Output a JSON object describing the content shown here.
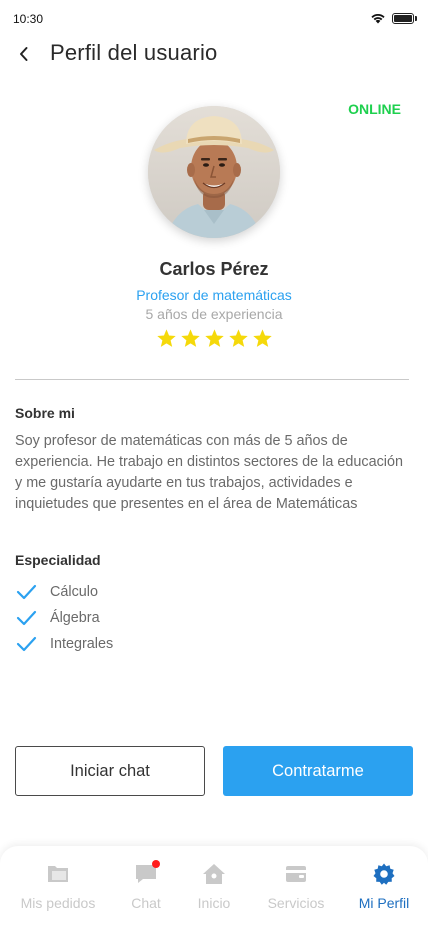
{
  "status_bar": {
    "time": "10:30"
  },
  "header": {
    "title": "Perfil del usuario"
  },
  "profile": {
    "status": "ONLINE",
    "name": "Carlos Pérez",
    "role": "Profesor de matemáticas",
    "experience": "5 años de experiencia",
    "rating": 5,
    "rating_max": 5
  },
  "about": {
    "title": "Sobre mi",
    "text": "Soy profesor de matemáticas con más de 5 años de experiencia. He trabajo en distintos sectores de la educación y me gustaría ayudarte en tus trabajos, actividades e inquietudes que presentes en el área de Matemáticas"
  },
  "speciality": {
    "title": "Especialidad",
    "items": [
      "Cálculo",
      "Álgebra",
      "Integrales"
    ]
  },
  "actions": {
    "chat_label": "Iniciar chat",
    "hire_label": "Contratarme"
  },
  "nav": {
    "items": [
      {
        "label": "Mis pedidos",
        "icon": "folder-icon"
      },
      {
        "label": "Chat",
        "icon": "chat-icon"
      },
      {
        "label": "Inicio",
        "icon": "home-icon"
      },
      {
        "label": "Servicios",
        "icon": "wallet-icon"
      },
      {
        "label": "Mi Perfil",
        "icon": "gear-icon"
      }
    ],
    "active": "Mi Perfil"
  },
  "colors": {
    "accent": "#2ba1f0",
    "online": "#1ed04e",
    "star": "#f5d90a",
    "nav_active": "#1e6fc0",
    "nav_inactive": "#c9c9c9",
    "notification": "#ff1d1d"
  }
}
